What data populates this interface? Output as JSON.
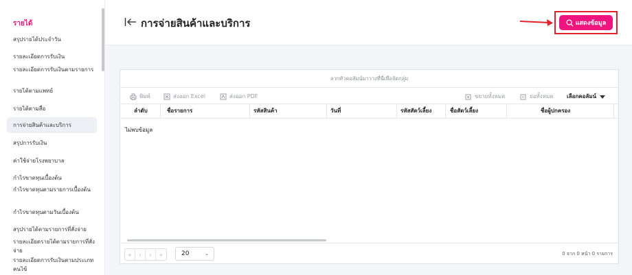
{
  "sidebar": {
    "section": "รายได้",
    "items": [
      "สรุปรายได้ประจำวัน",
      "รายละเอียดการรับเงิน",
      "รายละเอียดการรับเงินตามรายการ",
      "รายได้ตามแพทย์",
      "รายได้ตามสื่อ",
      "การจ่ายสินค้าและบริการ",
      "สรุปการรับเงิน",
      "ค่าใช้จ่ายโรงพยาบาล",
      "กำไรขาดทุนเบื้องต้น",
      "กำไรขาดทุนตามรายการเบื้องต้น",
      "กำไรขาดทุนตามวันเบื้องต้น",
      "สรุปรายได้ตามรายการที่สั่งจ่าย",
      "รายละเอียดรายได้ตามรายการที่สั่งจ่าย",
      "รายละเอียดการรับเงินตามประเภทคนไข้"
    ]
  },
  "header": {
    "title": "การจ่ายสินค้าและบริการ",
    "show_button": "แสดงข้อมูล"
  },
  "grid": {
    "group_panel": "ลากหัวคอลัมน์มาวางที่นี่เพื่อจัดกลุ่ม",
    "toolbar": {
      "print": "พิมพ์",
      "export_excel": "ส่งออก Excel",
      "export_pdf": "ส่งออก PDF",
      "expand_all": "ขยายทั้งหมด",
      "collapse_all": "ย่อทั้งหมด",
      "choose_columns": "เลือกคอลัมน์"
    },
    "columns": [
      "ลำดับ",
      "ชื่อรายการ",
      "รหัสสินค้า",
      "วันที่",
      "รหัสสัตว์เลี้ยง",
      "ชื่อสัตว์เลี้ยง",
      "ชื่อผู้ปกครอง"
    ],
    "empty_text": "ไม่พบข้อมูล",
    "page_size": "20",
    "page_info": "0 จาก 0 หน้า 0 รายการ",
    "pager": [
      "«",
      "‹",
      "›",
      "»"
    ]
  },
  "colors": {
    "accent": "#f0147f",
    "annotation_red": "#e4202b",
    "section_pink": "#e8147d"
  }
}
